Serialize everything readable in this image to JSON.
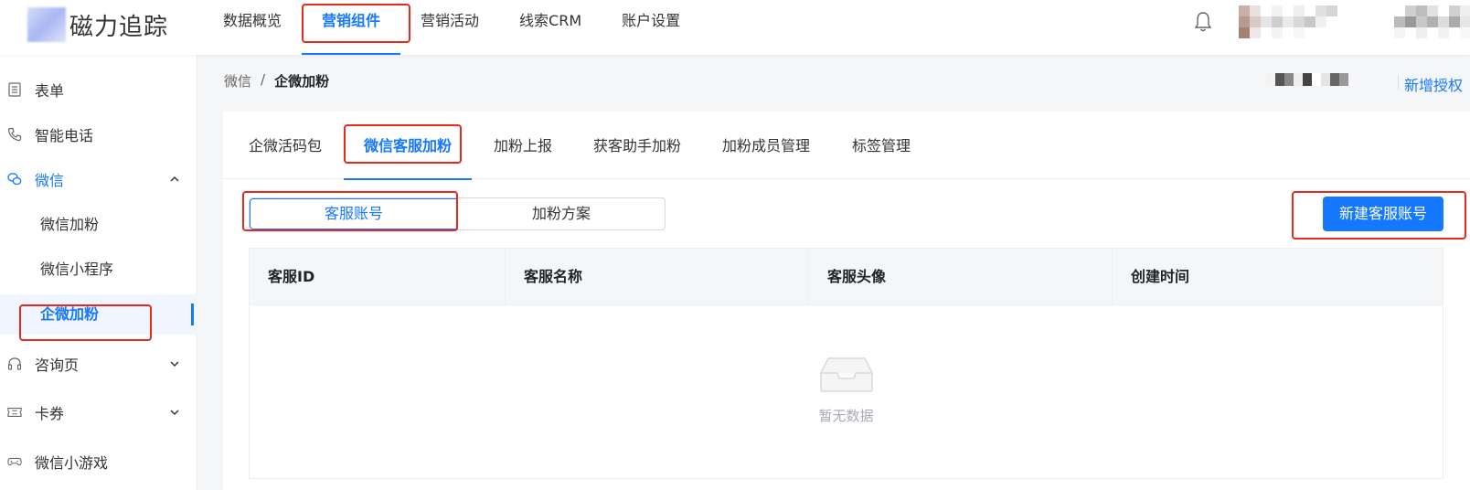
{
  "header": {
    "logo_text": "磁力追踪",
    "nav": [
      {
        "label": "数据概览"
      },
      {
        "label": "营销组件",
        "active": true
      },
      {
        "label": "营销活动"
      },
      {
        "label": "线索CRM"
      },
      {
        "label": "账户设置"
      }
    ],
    "icons": {
      "notification": "bell-icon"
    }
  },
  "sidebar": {
    "items": [
      {
        "label": "表单",
        "icon": "form-icon"
      },
      {
        "label": "智能电话",
        "icon": "phone-icon"
      },
      {
        "label": "微信",
        "icon": "wechat-icon",
        "expanded": true,
        "children": [
          {
            "label": "微信加粉"
          },
          {
            "label": "微信小程序"
          },
          {
            "label": "企微加粉",
            "active": true
          }
        ]
      },
      {
        "label": "咨询页",
        "icon": "headset-icon"
      },
      {
        "label": "卡券",
        "icon": "ticket-icon"
      },
      {
        "label": "微信小游戏",
        "icon": "gamepad-icon"
      }
    ]
  },
  "breadcrumb": {
    "parent": "微信",
    "separator": "/",
    "current": "企微加粉"
  },
  "top_action": {
    "new_auth_label": "新增授权"
  },
  "tabs": [
    {
      "label": "企微活码包"
    },
    {
      "label": "微信客服加粉",
      "active": true
    },
    {
      "label": "加粉上报"
    },
    {
      "label": "获客助手加粉"
    },
    {
      "label": "加粉成员管理"
    },
    {
      "label": "标签管理"
    }
  ],
  "segment": [
    {
      "label": "客服账号",
      "active": true
    },
    {
      "label": "加粉方案"
    }
  ],
  "create_button_label": "新建客服账号",
  "table": {
    "columns": [
      "客服ID",
      "客服名称",
      "客服头像",
      "创建时间"
    ],
    "rows": [],
    "empty_text": "暂无数据"
  },
  "colors": {
    "accent": "#1677ff",
    "annotation": "#e8291c"
  }
}
